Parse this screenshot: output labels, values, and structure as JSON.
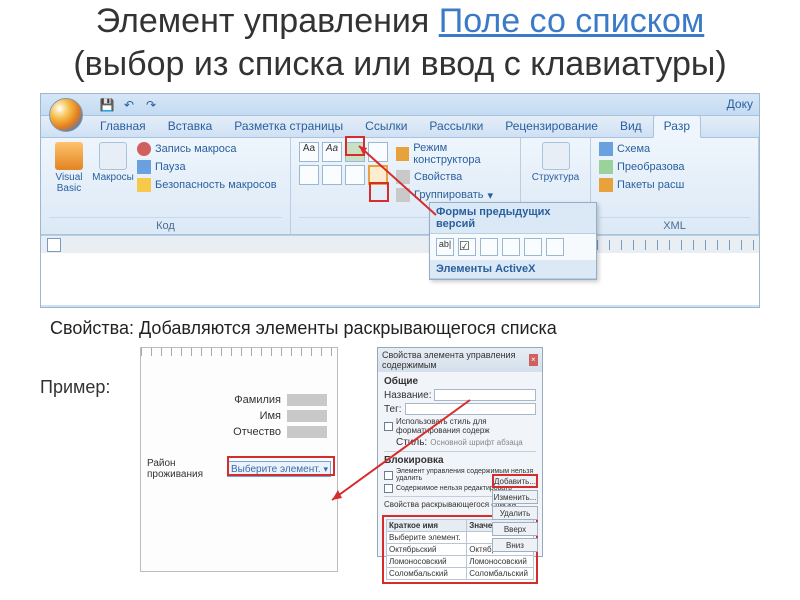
{
  "title": {
    "pre": "Элемент управления ",
    "hl": "Поле со списком",
    "post": " (выбор из списка или ввод с клавиатуры)"
  },
  "qat": {
    "doc_label": "Доку"
  },
  "tabs": [
    "Главная",
    "Вставка",
    "Разметка страницы",
    "Ссылки",
    "Рассылки",
    "Рецензирование",
    "Вид",
    "Разр"
  ],
  "active_tab": 7,
  "ribbon": {
    "code_group": {
      "label": "Код",
      "visual_basic": "Visual Basic",
      "macros": "Макросы",
      "record": "Запись макроса",
      "pause": "Пауза",
      "security": "Безопасность макросов"
    },
    "controls_group": {
      "design_mode": "Режим конструктора",
      "properties": "Свойства",
      "group": "Группировать"
    },
    "structure_group": {
      "label": "Структура"
    },
    "xml_group": {
      "label": "XML",
      "schema": "Схема",
      "transform": "Преобразова",
      "packs": "Пакеты расш"
    }
  },
  "dropdown": {
    "legacy": "Формы предыдущих версий",
    "activex": "Элементы ActiveX"
  },
  "caption": "Свойства: Добавляются  элементы раскрывающегося списка",
  "example": {
    "label": "Пример:",
    "fields": [
      "Фамилия",
      "Имя",
      "Отчество"
    ],
    "combo_label": "Район проживания",
    "combo_value": "Выберите элемент."
  },
  "props_dialog": {
    "title": "Свойства элемента управления содержимым",
    "general": "Общие",
    "name": "Название:",
    "tag": "Тег:",
    "use_style": "Использовать стиль для форматирования содерж",
    "style": "Стиль:",
    "style_val": "Основной шрифт абзаца",
    "lock": "Блокировка",
    "lock1": "Элемент управления содержимым нельзя удалить",
    "lock2": "Содержимое нельзя редактировать",
    "list_props": "Свойства раскрывающегося списка",
    "cols": [
      "Краткое имя",
      "Значение"
    ],
    "rows": [
      [
        "Выберите элемент.",
        ""
      ],
      [
        "Октябрьский",
        "Октябрьский"
      ],
      [
        "Ломоносовский",
        "Ломоносовский"
      ],
      [
        "Соломбальский",
        "Соломбальский"
      ]
    ],
    "btns": {
      "add": "Добавить...",
      "edit": "Изменить...",
      "del": "Удалить",
      "up": "Вверх",
      "down": "Вниз"
    }
  }
}
